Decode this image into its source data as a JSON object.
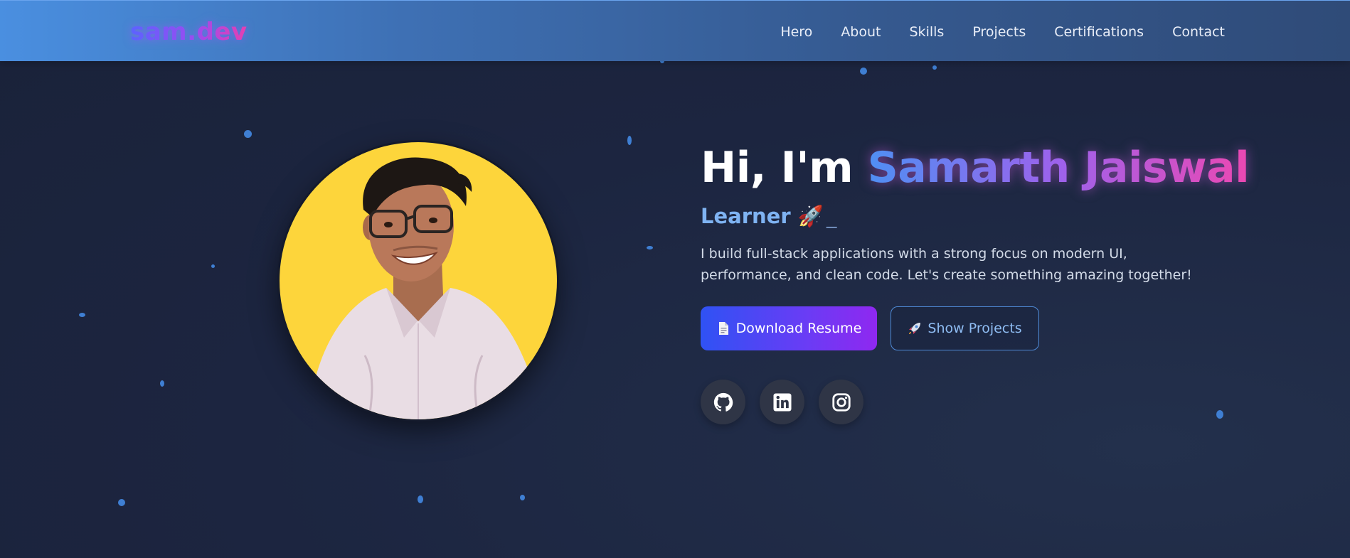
{
  "navbar": {
    "logo": "sam.dev",
    "links": [
      "Hero",
      "About",
      "Skills",
      "Projects",
      "Certifications",
      "Contact"
    ]
  },
  "hero": {
    "greeting": "Hi, I'm ",
    "name": "Samarth Jaiswal",
    "role": "Learner 🚀",
    "cursor": "_",
    "description": "I build full-stack applications with a strong focus on modern UI, performance, and clean code. Let's create something amazing together!",
    "primary_button": "Download Resume",
    "secondary_button": "Show Projects",
    "socials": [
      "github-icon",
      "linkedin-icon",
      "instagram-icon"
    ]
  },
  "colors": {
    "background": "#1c2540",
    "accent_blue": "#4f8ff3",
    "accent_pink": "#ec48b2",
    "avatar_bg": "#fdd53b"
  }
}
